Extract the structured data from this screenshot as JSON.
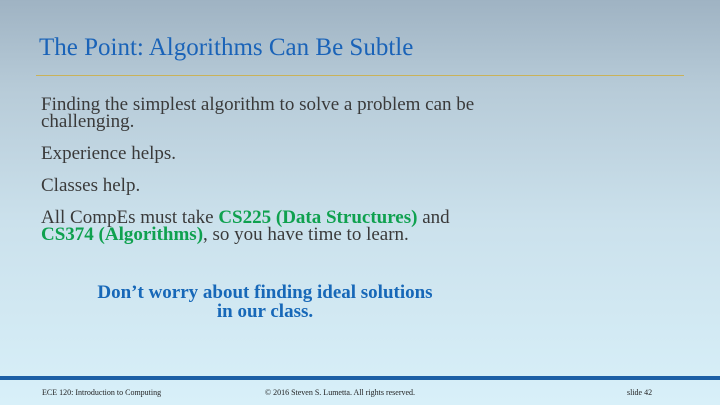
{
  "slide": {
    "title": "The Point: Algorithms Can Be Subtle",
    "paragraphs": [
      {
        "text": "Finding the simplest algorithm to solve a problem can be challenging."
      },
      {
        "text": "Experience helps."
      },
      {
        "text": "Classes help."
      }
    ],
    "req": {
      "prefix": "All CompEs must take ",
      "course1": "CS225 (Data Structures)",
      "mid": " and ",
      "course2": "CS374 (Algorithms)",
      "suffix": ", so you have time to learn."
    },
    "callout": "Don’t worry about finding ideal solutions in our class.",
    "colors": {
      "title": "#1a63b8",
      "highlight": "#0fa14f",
      "callout": "#1768b8",
      "rule": "#c9b25a",
      "footer_bar": "#1c5fa6"
    }
  },
  "footer": {
    "course": "ECE 120: Introduction to Computing",
    "copyright": "© 2016 Steven S. Lumetta.  All rights reserved.",
    "slide_number": "slide 42"
  }
}
